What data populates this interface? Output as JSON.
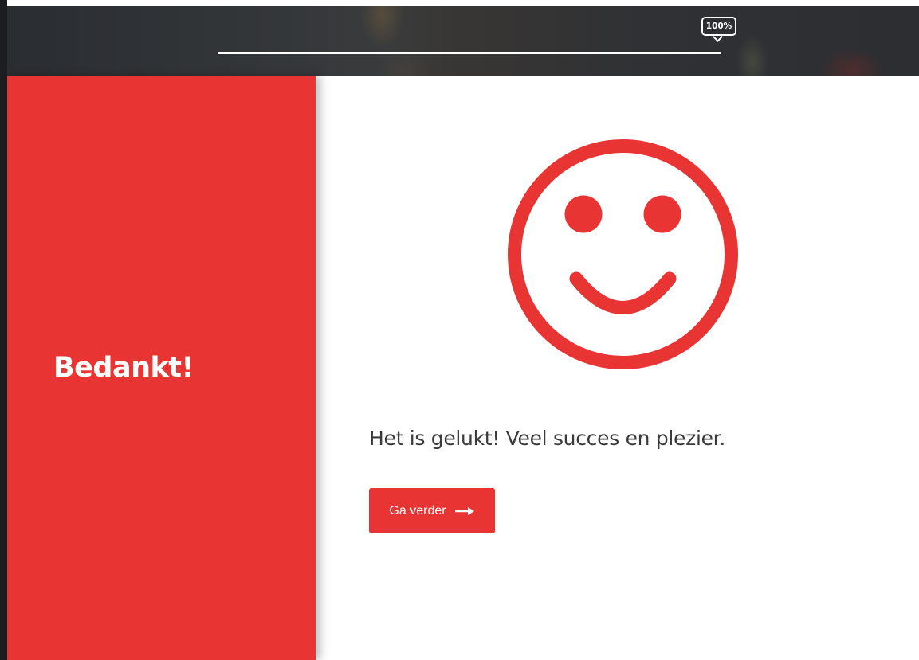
{
  "header": {
    "progress": {
      "value_percent": 100,
      "label": "100%"
    }
  },
  "side_panel": {
    "title": "Bedankt!"
  },
  "main": {
    "icon": "smiley-icon",
    "message": "Het is gelukt! Veel succes en plezier.",
    "continue_button": {
      "label": "Ga verder",
      "icon": "arrow-right-icon"
    }
  },
  "colors": {
    "accent": "#e93434",
    "header_bg": "#2d2f32",
    "text": "#3a3a3a"
  }
}
